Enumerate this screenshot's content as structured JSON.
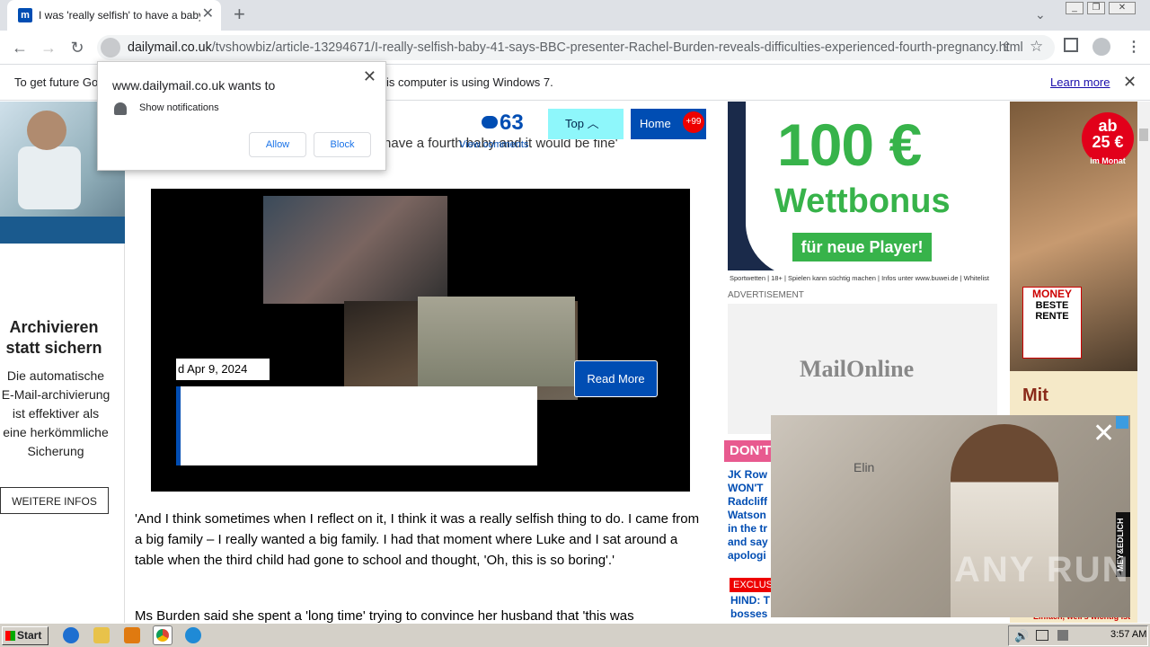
{
  "browser": {
    "tab_title": "I was 'really selfish' to have a baby at 41",
    "url_domain": "dailymail.co.uk",
    "url_path": "/tvshowbiz/article-13294671/I-really-selfish-baby-41-says-BBC-presenter-Rachel-Burden-reveals-difficulties-experienced-fourth-pregnancy.html",
    "new_tab": "+",
    "favicon": "m"
  },
  "infobar": {
    "text_start": "To get future Go",
    "text_end": "is computer is using Windows 7.",
    "learn_more": "Learn more"
  },
  "notification": {
    "title": "www.dailymail.co.uk wants to",
    "permission": "Show notifications",
    "allow": "Allow",
    "block": "Block"
  },
  "left_ad": {
    "heading": "Archivieren statt sichern",
    "body": "Die automatische E-Mail-archivierung ist effektiver als eine herkömmliche Sicherung",
    "cta": "WEITERE INFOS"
  },
  "article": {
    "comment_count": "63",
    "view_comments": "View comments",
    "top_label": "Top",
    "home_label": "Home",
    "home_badge": "+99",
    "cut_text": "n I'd have a fourth baby and it would be fine'",
    "video_date": "d Apr 9, 2024",
    "read_more": "Read More",
    "paragraph1": "'And I think sometimes when I reflect on it, I think it was a really selfish thing to do. I came from a big family – I really wanted a big family. I had that moment where Luke and I sat around a table when the third child had gone to school and thought, 'Oh, this is so boring'.'",
    "paragraph2": "Ms Burden said she spent a 'long time' trying to convince her husband that 'this was"
  },
  "right_col": {
    "ad_big": "100 €",
    "ad_word": "Wettbonus",
    "ad_pill": "für neue Player!",
    "ad_fine": "Sportwetten | 18+ | Spielen kann süchtig machen | Infos unter www.buwei.de | Whitelist",
    "advert_label": "ADVERTISEMENT",
    "mail_logo": "MailOnline",
    "dont_label": "DON'T",
    "dm_items": "JK Row WON'T Radcliff Watson in the tr and say apologi",
    "exclusive": "EXCLUS",
    "hind": "HIND: T bosses"
  },
  "far_ad": {
    "circle_top": "ab",
    "circle_value": "25 €",
    "circle_unit": "im Monat",
    "money": "MONEY",
    "rente_line1": "BESTE",
    "rente_line2": "RENTE",
    "mit": "Mit",
    "bottom": "Einfach, weil's wichtig ist"
  },
  "video_popup": {
    "close": "✕",
    "brand": "MEY&EDLICH",
    "shop_text": "Elin"
  },
  "watermark": "ANY RUN",
  "taskbar": {
    "start": "Start",
    "clock": "3:57 AM"
  }
}
